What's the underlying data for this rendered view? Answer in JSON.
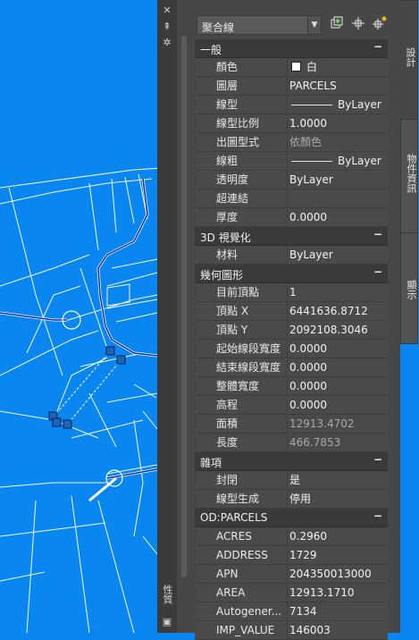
{
  "title": "性質",
  "selector": {
    "value": "聚合線"
  },
  "toolbar_icons": [
    "quick-select-icon",
    "select-objects-icon",
    "pickadd-icon"
  ],
  "left_icons": [
    "close-icon",
    "autohide-icon",
    "settings-icon"
  ],
  "categories": [
    {
      "label": "一般",
      "toggle": "−",
      "rows": [
        {
          "name": "顏色",
          "value": "白",
          "type": "color"
        },
        {
          "name": "圖層",
          "value": "PARCELS"
        },
        {
          "name": "線型",
          "value": "ByLayer",
          "type": "linetype"
        },
        {
          "name": "線型比例",
          "value": "1.0000"
        },
        {
          "name": "出圖型式",
          "value": "依顏色",
          "readonly": true
        },
        {
          "name": "線粗",
          "value": "ByLayer",
          "type": "linetype"
        },
        {
          "name": "透明度",
          "value": "ByLayer"
        },
        {
          "name": "超連結",
          "value": ""
        },
        {
          "name": "厚度",
          "value": "0.0000"
        }
      ]
    },
    {
      "label": "3D 視覺化",
      "toggle": "−",
      "rows": [
        {
          "name": "材料",
          "value": "ByLayer"
        }
      ]
    },
    {
      "label": "幾何圖形",
      "toggle": "−",
      "rows": [
        {
          "name": "目前頂點",
          "value": "1"
        },
        {
          "name": "頂點 X",
          "value": "6441636.8712"
        },
        {
          "name": "頂點 Y",
          "value": "2092108.3046"
        },
        {
          "name": "起始線段寬度",
          "value": "0.0000"
        },
        {
          "name": "結束線段寬度",
          "value": "0.0000"
        },
        {
          "name": "整體寬度",
          "value": "0.0000"
        },
        {
          "name": "高程",
          "value": "0.0000"
        },
        {
          "name": "面積",
          "value": "12913.4702",
          "readonly": true
        },
        {
          "name": "長度",
          "value": "466.7853",
          "readonly": true
        }
      ]
    },
    {
      "label": "雜項",
      "toggle": "−",
      "rows": [
        {
          "name": "封閉",
          "value": "是"
        },
        {
          "name": "線型生成",
          "value": "停用"
        }
      ]
    },
    {
      "label": "OD:PARCELS",
      "toggle": "−",
      "rows": [
        {
          "name": "ACRES",
          "value": "0.2960"
        },
        {
          "name": "ADDRESS",
          "value": "1729"
        },
        {
          "name": "APN",
          "value": "204350013000"
        },
        {
          "name": "AREA",
          "value": "12913.1710"
        },
        {
          "name": "Autogener...",
          "value": "7134"
        },
        {
          "name": "IMP_VALUE",
          "value": "146003"
        }
      ]
    }
  ],
  "tabs": [
    {
      "label": "設計",
      "active": true
    },
    {
      "label": "物件資訊",
      "active": false
    },
    {
      "label": "顯示",
      "active": false
    }
  ],
  "colors": {
    "map_bg": "#0a86f0",
    "panel_bg": "#474747",
    "category_bg": "#3a3a3a",
    "road": "#0a2aa8"
  }
}
